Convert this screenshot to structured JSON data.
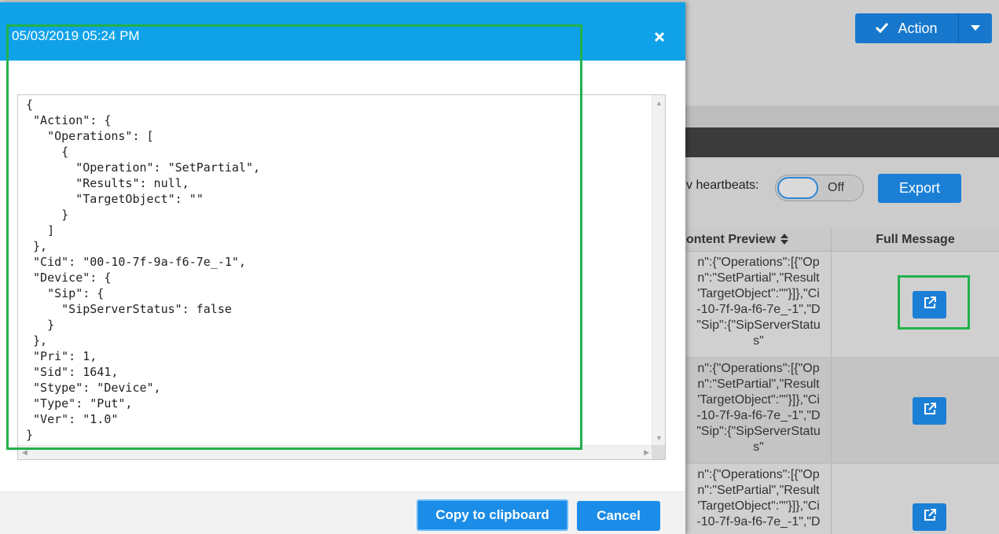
{
  "header": {
    "action_label": "Action",
    "action_icon": "checkmark-icon",
    "action_caret_icon": "caret-down-icon"
  },
  "controls": {
    "heartbeats_label": "v heartbeats:",
    "toggle_state": "Off",
    "export_label": "Export"
  },
  "table": {
    "columns": [
      "ontent Preview",
      "Full Message"
    ],
    "rows": [
      {
        "preview": "n\":{\"Operations\":[{\"Op\nn\":\"SetPartial\",\"Result\n'TargetObject\":\"\"}]},\"Ci\n-10-7f-9a-f6-7e_-1\",\"D\n\"Sip\":{\"SipServerStatu\ns\""
      },
      {
        "preview": "n\":{\"Operations\":[{\"Op\nn\":\"SetPartial\",\"Result\n'TargetObject\":\"\"}]},\"Ci\n-10-7f-9a-f6-7e_-1\",\"D\n\"Sip\":{\"SipServerStatu\ns\""
      },
      {
        "preview": "n\":{\"Operations\":[{\"Op\nn\":\"SetPartial\",\"Result\n'TargetObject\":\"\"}]},\"Ci\n-10-7f-9a-f6-7e_-1\",\"D"
      }
    ]
  },
  "modal": {
    "title": "05/03/2019 05:24 PM",
    "close_icon": "close-icon",
    "json_text": "{\n \"Action\": {\n   \"Operations\": [\n     {\n       \"Operation\": \"SetPartial\",\n       \"Results\": null,\n       \"TargetObject\": \"\"\n     }\n   ]\n },\n \"Cid\": \"00-10-7f-9a-f6-7e_-1\",\n \"Device\": {\n   \"Sip\": {\n     \"SipServerStatus\": false\n   }\n },\n \"Pri\": 1,\n \"Sid\": 1641,\n \"Stype\": \"Device\",\n \"Type\": \"Put\",\n \"Ver\": \"1.0\"\n}",
    "copy_label": "Copy to clipboard",
    "cancel_label": "Cancel"
  },
  "colors": {
    "modal_header": "#0fa2e8",
    "primary_button": "#1b8ce8",
    "highlight": "#22b14c"
  }
}
